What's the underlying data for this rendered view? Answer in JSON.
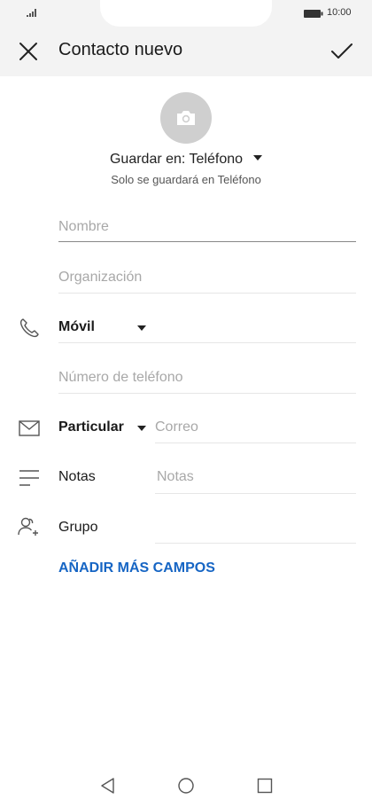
{
  "status_bar": {
    "time": "10:00"
  },
  "app_bar": {
    "title": "Contacto nuevo"
  },
  "save_location": {
    "label": "Guardar en: Teléfono",
    "note": "Solo se guardará en Teléfono"
  },
  "fields": {
    "name_placeholder": "Nombre",
    "organization_placeholder": "Organización",
    "phone_type": "Móvil",
    "phone_placeholder": "Número de teléfono",
    "email_type": "Particular",
    "email_placeholder": "Correo",
    "notes_label": "Notas",
    "notes_placeholder": "Notas",
    "group_label": "Grupo"
  },
  "add_more_fields": "AÑADIR MÁS CAMPOS",
  "colors": {
    "accent": "#1665c4",
    "bar_bg": "#f3f3f3",
    "avatar_bg": "#cfcfcf"
  }
}
